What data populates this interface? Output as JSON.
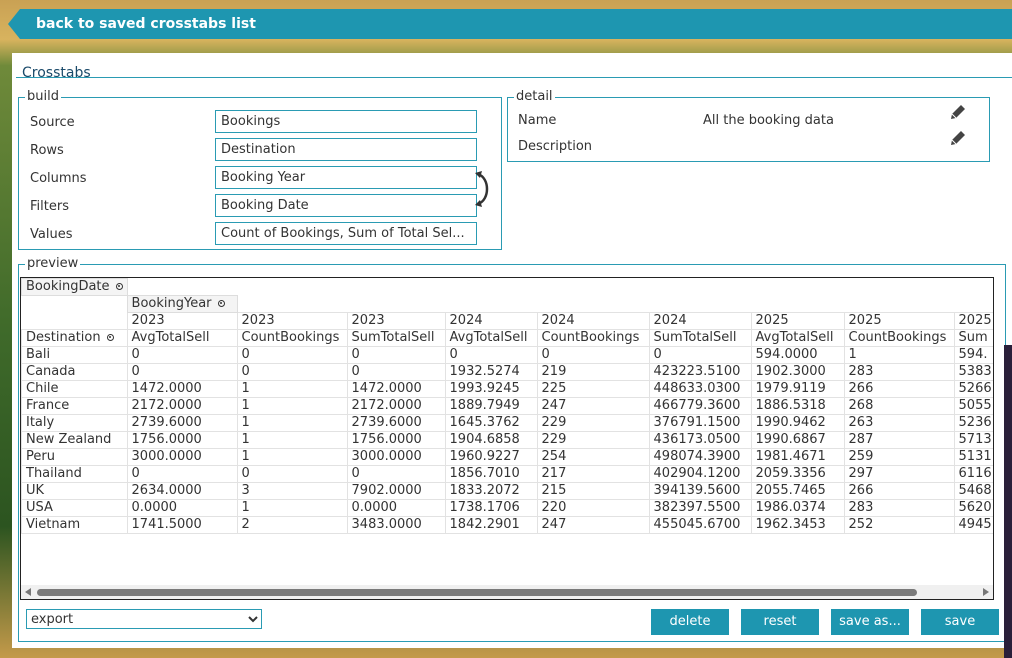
{
  "topbar": {
    "back_label": "back to saved crosstabs list"
  },
  "panel": {
    "title": "Crosstabs"
  },
  "build": {
    "legend": "build",
    "rows": [
      {
        "label": "Source",
        "value": "Bookings"
      },
      {
        "label": "Rows",
        "value": "Destination"
      },
      {
        "label": "Columns",
        "value": "Booking Year"
      },
      {
        "label": "Filters",
        "value": "Booking Date"
      },
      {
        "label": "Values",
        "value": "Count of Bookings, Sum of Total Sel..."
      }
    ],
    "swap_icon": "swap-arrows-icon"
  },
  "detail": {
    "legend": "detail",
    "name_label": "Name",
    "name_value": "All the booking data",
    "description_label": "Description",
    "description_value": "",
    "edit_icon": "pencil-icon"
  },
  "preview": {
    "legend": "preview",
    "filter_field": "BookingDate",
    "column_field": "BookingYear",
    "row_field": "Destination",
    "years": [
      "2023",
      "2023",
      "2023",
      "2024",
      "2024",
      "2024",
      "2025",
      "2025",
      "2025"
    ],
    "measures": [
      "AvgTotalSell",
      "CountBookings",
      "SumTotalSell",
      "AvgTotalSell",
      "CountBookings",
      "SumTotalSell",
      "AvgTotalSell",
      "CountBookings",
      "Sum"
    ],
    "rows": [
      {
        "dest": "Bali",
        "vals": [
          "0",
          "0",
          "0",
          "0",
          "0",
          "0",
          "594.0000",
          "1",
          "594."
        ]
      },
      {
        "dest": "Canada",
        "vals": [
          "0",
          "0",
          "0",
          "1932.5274",
          "219",
          "423223.5100",
          "1902.3000",
          "283",
          "5383"
        ]
      },
      {
        "dest": "Chile",
        "vals": [
          "1472.0000",
          "1",
          "1472.0000",
          "1993.9245",
          "225",
          "448633.0300",
          "1979.9119",
          "266",
          "5266"
        ]
      },
      {
        "dest": "France",
        "vals": [
          "2172.0000",
          "1",
          "2172.0000",
          "1889.7949",
          "247",
          "466779.3600",
          "1886.5318",
          "268",
          "5055"
        ]
      },
      {
        "dest": "Italy",
        "vals": [
          "2739.6000",
          "1",
          "2739.6000",
          "1645.3762",
          "229",
          "376791.1500",
          "1990.9462",
          "263",
          "5236"
        ]
      },
      {
        "dest": "New Zealand",
        "vals": [
          "1756.0000",
          "1",
          "1756.0000",
          "1904.6858",
          "229",
          "436173.0500",
          "1990.6867",
          "287",
          "5713"
        ]
      },
      {
        "dest": "Peru",
        "vals": [
          "3000.0000",
          "1",
          "3000.0000",
          "1960.9227",
          "254",
          "498074.3900",
          "1981.4671",
          "259",
          "5131"
        ]
      },
      {
        "dest": "Thailand",
        "vals": [
          "0",
          "0",
          "0",
          "1856.7010",
          "217",
          "402904.1200",
          "2059.3356",
          "297",
          "6116"
        ]
      },
      {
        "dest": "UK",
        "vals": [
          "2634.0000",
          "3",
          "7902.0000",
          "1833.2072",
          "215",
          "394139.5600",
          "2055.7465",
          "266",
          "5468"
        ]
      },
      {
        "dest": "USA",
        "vals": [
          "0.0000",
          "1",
          "0.0000",
          "1738.1706",
          "220",
          "382397.5500",
          "1986.0374",
          "283",
          "5620"
        ]
      },
      {
        "dest": "Vietnam",
        "vals": [
          "1741.5000",
          "2",
          "3483.0000",
          "1842.2901",
          "247",
          "455045.6700",
          "1962.3453",
          "252",
          "4945"
        ]
      }
    ]
  },
  "footer": {
    "export_selected": "export",
    "delete_label": "delete",
    "reset_label": "reset",
    "save_as_label": "save as...",
    "save_label": "save"
  },
  "colors": {
    "accent": "#1e96b0",
    "border": "#2a9bb3"
  }
}
